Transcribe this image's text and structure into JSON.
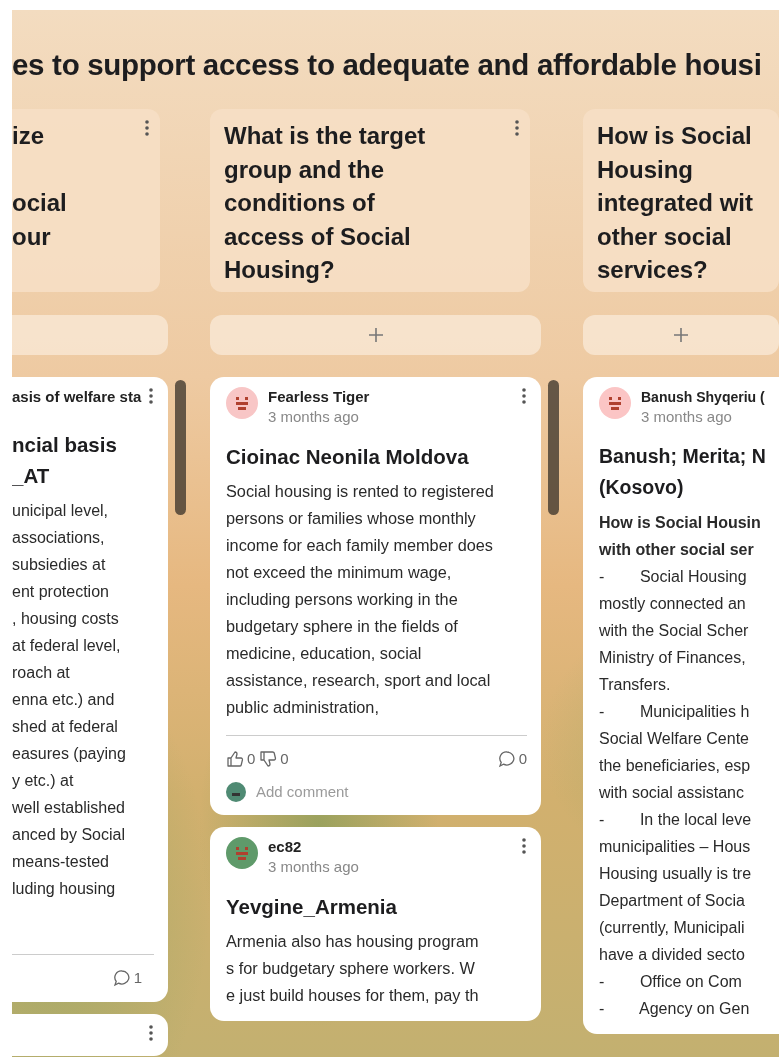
{
  "board": {
    "title": "es to support access to adequate and affordable housi"
  },
  "columns": [
    {
      "header_lines": [
        "ize",
        "ocial",
        "our"
      ],
      "has_menu": true,
      "add_plus": false,
      "scrollbar": true,
      "posts": [
        {
          "kind": "card",
          "author": "asis of welfare sta",
          "menu": true,
          "title_lines": [
            "ncial basis",
            "_AT"
          ],
          "body_lines": [
            "unicipal level,",
            "associations,",
            "subsiedies at",
            "ent protection",
            ", housing costs",
            "at federal level,",
            "roach at",
            "enna etc.) and",
            "shed at federal",
            "easures (paying",
            "y etc.) at",
            "well established",
            "anced by Social",
            "means-tested",
            "luding housing"
          ],
          "reactions": {
            "comments": "1"
          }
        },
        {
          "kind": "stub",
          "menu": true
        }
      ]
    },
    {
      "header_lines": [
        "What is the target",
        "group and the",
        "conditions of",
        "access of Social",
        "Housing?"
      ],
      "has_menu": true,
      "add_plus": true,
      "scrollbar": true,
      "posts": [
        {
          "kind": "card",
          "color": "#f8c6c6",
          "author": "Fearless Tiger",
          "time": "3 months ago",
          "menu": true,
          "title_lines": [
            "Cioinac Neonila Moldova"
          ],
          "body": "Social housing is rented to registered persons or families whose monthly income for each family member does not exceed the minimum wage, including persons working in the budgetary sphere in the fields of medicine, education, social assistance, research, sport and local public administration,",
          "reactions": {
            "likes": "0",
            "dislikes": "0",
            "comments": "0"
          },
          "comment_placeholder": "Add comment"
        },
        {
          "kind": "card",
          "color": "#5f9a6a",
          "author": "ec82",
          "time": "3 months ago",
          "menu": true,
          "title_lines": [
            "Yevgine_Armenia"
          ],
          "body_lines": [
            "Armenia also has housing program",
            "s for budgetary sphere workers. W",
            "e just build houses for them, pay th"
          ]
        }
      ]
    },
    {
      "header_lines": [
        "How is Social",
        "Housing",
        "integrated wit",
        "other social",
        "services?"
      ],
      "has_menu": false,
      "add_plus": true,
      "scrollbar": false,
      "posts": [
        {
          "kind": "card",
          "color": "#fbc5c5",
          "author": "Banush Shyqeriu (",
          "time": "3 months ago",
          "menu": false,
          "title_lines": [
            "Banush; Merita; N",
            "(Kosovo)"
          ],
          "body_lines": [
            "**How is Social Housin**",
            "**with other social ser**",
            "-        Social Housing",
            "mostly connected an",
            "with the Social Scher",
            "Ministry of Finances,",
            "Transfers.",
            "-        Municipalities h",
            "Social Welfare Cente",
            "the beneficiaries, esp",
            "with social assistanc",
            "-        In the local leve",
            "municipalities – Hous",
            "Housing usually is tre",
            "Department of Socia",
            "(currently, Municipali",
            "have a divided secto",
            "-        Office on Com",
            "-        Agency on Gen"
          ]
        }
      ]
    }
  ]
}
